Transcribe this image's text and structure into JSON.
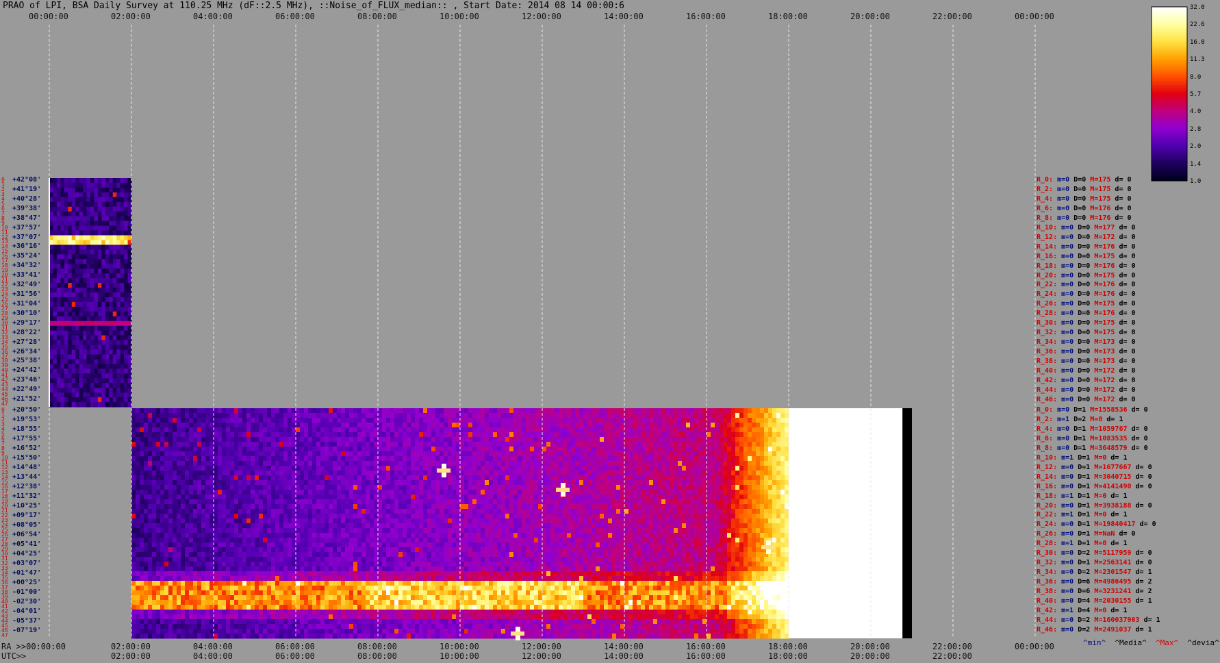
{
  "title": "PRAO of LPI, BSA Daily Survey at 110.25 MHz (dF::2.5 MHz), ::Noise_of_FLUX_median:: , Start Date: 2014 08 14 00:00:6",
  "colors": {
    "background": "#9a9a9a",
    "grid": "#e8e8e8",
    "saturated": "#ffffff",
    "nodata": "#000000"
  },
  "chart_data": {
    "type": "heatmap",
    "x_ticks_top": [
      "00:00:00",
      "02:00:00",
      "04:00:00",
      "06:00:00",
      "08:00:00",
      "10:00:00",
      "12:00:00",
      "14:00:00",
      "16:00:00",
      "18:00:00",
      "20:00:00",
      "22:00:00",
      "00:00:00"
    ],
    "x_ticks_bottom_1": [
      "RA >>00:00:00",
      "02:00:00",
      "04:00:00",
      "06:00:00",
      "08:00:00",
      "10:00:00",
      "12:00:00",
      "14:00:00",
      "16:00:00",
      "18:00:00",
      "20:00:00",
      "22:00:00",
      "00:00:00"
    ],
    "x_ticks_bottom_2": [
      "UTC>>",
      "02:00:00",
      "04:00:00",
      "06:00:00",
      "08:00:00",
      "10:00:00",
      "12:00:00",
      "14:00:00",
      "16:00:00",
      "18:00:00",
      "20:00:00",
      "22:00:00"
    ],
    "upper_block": {
      "time_range_hours": [
        0,
        2
      ],
      "declinations": [
        "+42°08'",
        "+41°19'",
        "+40°28'",
        "+39°38'",
        "+38°47'",
        "+37°57'",
        "+37°07'",
        "+36°16'",
        "+35°24'",
        "+34°32'",
        "+33°41'",
        "+32°49'",
        "+31°56'",
        "+31°04'",
        "+30°10'",
        "+29°17'",
        "+28°22'",
        "+27°28'",
        "+26°34'",
        "+25°38'",
        "+24°42'",
        "+23°46'",
        "+22°49'",
        "+21°52'"
      ],
      "bright_row_index": 6
    },
    "lower_block": {
      "time_range_hours": [
        2,
        21
      ],
      "saturated_from_hours": 18,
      "declinations": [
        "+20°50'",
        "+19°53'",
        "+18°55'",
        "+17°55'",
        "+16°52'",
        "+15°50'",
        "+14°48'",
        "+13°44'",
        "+12°38'",
        "+11°32'",
        "+10°25'",
        "+09°17'",
        "+08°05'",
        "+06°54'",
        "+05°41'",
        "+04°25'",
        "+03°07'",
        "+01°47'",
        "+00°25'",
        "-01°00'",
        "-02°30'",
        "-04°01'",
        "-05°37'",
        "-07°19'"
      ],
      "bright_band_rows": [
        18,
        19,
        20
      ],
      "point_sources": [
        {
          "hour": 9.6,
          "row": 6
        },
        {
          "hour": 12.5,
          "row": 8
        },
        {
          "hour": 17.5,
          "row": 14
        },
        {
          "hour": 11.4,
          "row": 23
        }
      ]
    },
    "row_indices": [
      "0",
      "1",
      "2",
      "3",
      "4",
      "5",
      "6",
      "7",
      "8",
      "9",
      "10",
      "11",
      "12",
      "13",
      "14",
      "15",
      "16",
      "17",
      "18",
      "19",
      "20",
      "21",
      "22",
      "23",
      "24",
      "25",
      "26",
      "27",
      "28",
      "29",
      "30",
      "31",
      "32",
      "33",
      "34",
      "35",
      "36",
      "37",
      "38",
      "39",
      "40",
      "41",
      "42",
      "43",
      "44",
      "45",
      "46",
      "47"
    ],
    "colorbar": {
      "scale": "log",
      "ticks": [
        "32.0",
        "22.6",
        "16.0",
        "11.3",
        "8.0",
        "5.7",
        "4.0",
        "2.8",
        "2.0",
        "1.4",
        "1.0"
      ],
      "colors": [
        "#ffffff",
        "#ffffa0",
        "#ffe040",
        "#ffa000",
        "#ff5000",
        "#e00010",
        "#c00080",
        "#9000d0",
        "#5000b0",
        "#200060",
        "#000020"
      ]
    }
  },
  "stats_upper": [
    {
      "r": "R_0:",
      "m": "m=0",
      "D": "D=0",
      "M": "M=175",
      "d": "d= 0"
    },
    {
      "r": "R_2:",
      "m": "m=0",
      "D": "D=0",
      "M": "M=175",
      "d": "d= 0"
    },
    {
      "r": "R_4:",
      "m": "m=0",
      "D": "D=0",
      "M": "M=175",
      "d": "d= 0"
    },
    {
      "r": "R_6:",
      "m": "m=0",
      "D": "D=0",
      "M": "M=176",
      "d": "d= 0"
    },
    {
      "r": "R_8:",
      "m": "m=0",
      "D": "D=0",
      "M": "M=176",
      "d": "d= 0"
    },
    {
      "r": "R_10:",
      "m": "m=0",
      "D": "D=0",
      "M": "M=177",
      "d": "d= 0"
    },
    {
      "r": "R_12:",
      "m": "m=0",
      "D": "D=0",
      "M": "M=172",
      "d": "d= 0"
    },
    {
      "r": "R_14:",
      "m": "m=0",
      "D": "D=0",
      "M": "M=176",
      "d": "d= 0"
    },
    {
      "r": "R_16:",
      "m": "m=0",
      "D": "D=0",
      "M": "M=175",
      "d": "d= 0"
    },
    {
      "r": "R_18:",
      "m": "m=0",
      "D": "D=0",
      "M": "M=176",
      "d": "d= 0"
    },
    {
      "r": "R_20:",
      "m": "m=0",
      "D": "D=0",
      "M": "M=175",
      "d": "d= 0"
    },
    {
      "r": "R_22:",
      "m": "m=0",
      "D": "D=0",
      "M": "M=176",
      "d": "d= 0"
    },
    {
      "r": "R_24:",
      "m": "m=0",
      "D": "D=0",
      "M": "M=176",
      "d": "d= 0"
    },
    {
      "r": "R_26:",
      "m": "m=0",
      "D": "D=0",
      "M": "M=175",
      "d": "d= 0"
    },
    {
      "r": "R_28:",
      "m": "m=0",
      "D": "D=0",
      "M": "M=176",
      "d": "d= 0"
    },
    {
      "r": "R_30:",
      "m": "m=0",
      "D": "D=0",
      "M": "M=175",
      "d": "d= 0"
    },
    {
      "r": "R_32:",
      "m": "m=0",
      "D": "D=0",
      "M": "M=175",
      "d": "d= 0"
    },
    {
      "r": "R_34:",
      "m": "m=0",
      "D": "D=0",
      "M": "M=173",
      "d": "d= 0"
    },
    {
      "r": "R_36:",
      "m": "m=0",
      "D": "D=0",
      "M": "M=173",
      "d": "d= 0"
    },
    {
      "r": "R_38:",
      "m": "m=0",
      "D": "D=0",
      "M": "M=173",
      "d": "d= 0"
    },
    {
      "r": "R_40:",
      "m": "m=0",
      "D": "D=0",
      "M": "M=172",
      "d": "d= 0"
    },
    {
      "r": "R_42:",
      "m": "m=0",
      "D": "D=0",
      "M": "M=172",
      "d": "d= 0"
    },
    {
      "r": "R_44:",
      "m": "m=0",
      "D": "D=0",
      "M": "M=172",
      "d": "d= 0"
    },
    {
      "r": "R_46:",
      "m": "m=0",
      "D": "D=0",
      "M": "M=172",
      "d": "d= 0"
    }
  ],
  "stats_lower": [
    {
      "r": "R_0:",
      "m": "m=0",
      "D": "D=1",
      "M": "M=1558536",
      "d": "d= 0"
    },
    {
      "r": "R_2:",
      "m": "m=1",
      "D": "D=2",
      "M": "M=0",
      "d": "d= 1"
    },
    {
      "r": "R_4:",
      "m": "m=0",
      "D": "D=1",
      "M": "M=1059767",
      "d": "d= 0"
    },
    {
      "r": "R_6:",
      "m": "m=0",
      "D": "D=1",
      "M": "M=1083535",
      "d": "d= 0"
    },
    {
      "r": "R_8:",
      "m": "m=0",
      "D": "D=1",
      "M": "M=3648579",
      "d": "d= 0"
    },
    {
      "r": "R_10:",
      "m": "m=1",
      "D": "D=1",
      "M": "M=0",
      "d": "d= 1"
    },
    {
      "r": "R_12:",
      "m": "m=0",
      "D": "D=1",
      "M": "M=1677667",
      "d": "d= 0"
    },
    {
      "r": "R_14:",
      "m": "m=0",
      "D": "D=1",
      "M": "M=3040715",
      "d": "d= 0"
    },
    {
      "r": "R_16:",
      "m": "m=0",
      "D": "D=1",
      "M": "M=4141490",
      "d": "d= 0"
    },
    {
      "r": "R_18:",
      "m": "m=1",
      "D": "D=1",
      "M": "M=0",
      "d": "d= 1"
    },
    {
      "r": "R_20:",
      "m": "m=0",
      "D": "D=1",
      "M": "M=3938188",
      "d": "d= 0"
    },
    {
      "r": "R_22:",
      "m": "m=1",
      "D": "D=1",
      "M": "M=0",
      "d": "d= 1"
    },
    {
      "r": "R_24:",
      "m": "m=0",
      "D": "D=1",
      "M": "M=19840417",
      "d": "d= 0"
    },
    {
      "r": "R_26:",
      "m": "m=0",
      "D": "D=1",
      "M": "M=NaN",
      "d": "d= 0"
    },
    {
      "r": "R_28:",
      "m": "m=1",
      "D": "D=1",
      "M": "M=0",
      "d": "d= 1"
    },
    {
      "r": "R_30:",
      "m": "m=0",
      "D": "D=2",
      "M": "M=5117959",
      "d": "d= 0"
    },
    {
      "r": "R_32:",
      "m": "m=0",
      "D": "D=1",
      "M": "M=2563141",
      "d": "d= 0"
    },
    {
      "r": "R_34:",
      "m": "m=0",
      "D": "D=2",
      "M": "M=2301547",
      "d": "d= 1"
    },
    {
      "r": "R_36:",
      "m": "m=0",
      "D": "D=6",
      "M": "M=4986495",
      "d": "d= 2"
    },
    {
      "r": "R_38:",
      "m": "m=0",
      "D": "D=6",
      "M": "M=3231241",
      "d": "d= 2"
    },
    {
      "r": "R_40:",
      "m": "m=0",
      "D": "D=4",
      "M": "M=2030155",
      "d": "d= 1"
    },
    {
      "r": "R_42:",
      "m": "m=1",
      "D": "D=4",
      "M": "M=0",
      "d": "d= 1"
    },
    {
      "r": "R_44:",
      "m": "m=0",
      "D": "D=2",
      "M": "M=160037903",
      "d": "d= 1"
    },
    {
      "r": "R_46:",
      "m": "m=0",
      "D": "D=2",
      "M": "M=2491037",
      "d": "d= 1"
    }
  ],
  "legend": {
    "min": "^min^",
    "median": "^Media^",
    "max": "^Max^",
    "devia": "^devia^"
  }
}
